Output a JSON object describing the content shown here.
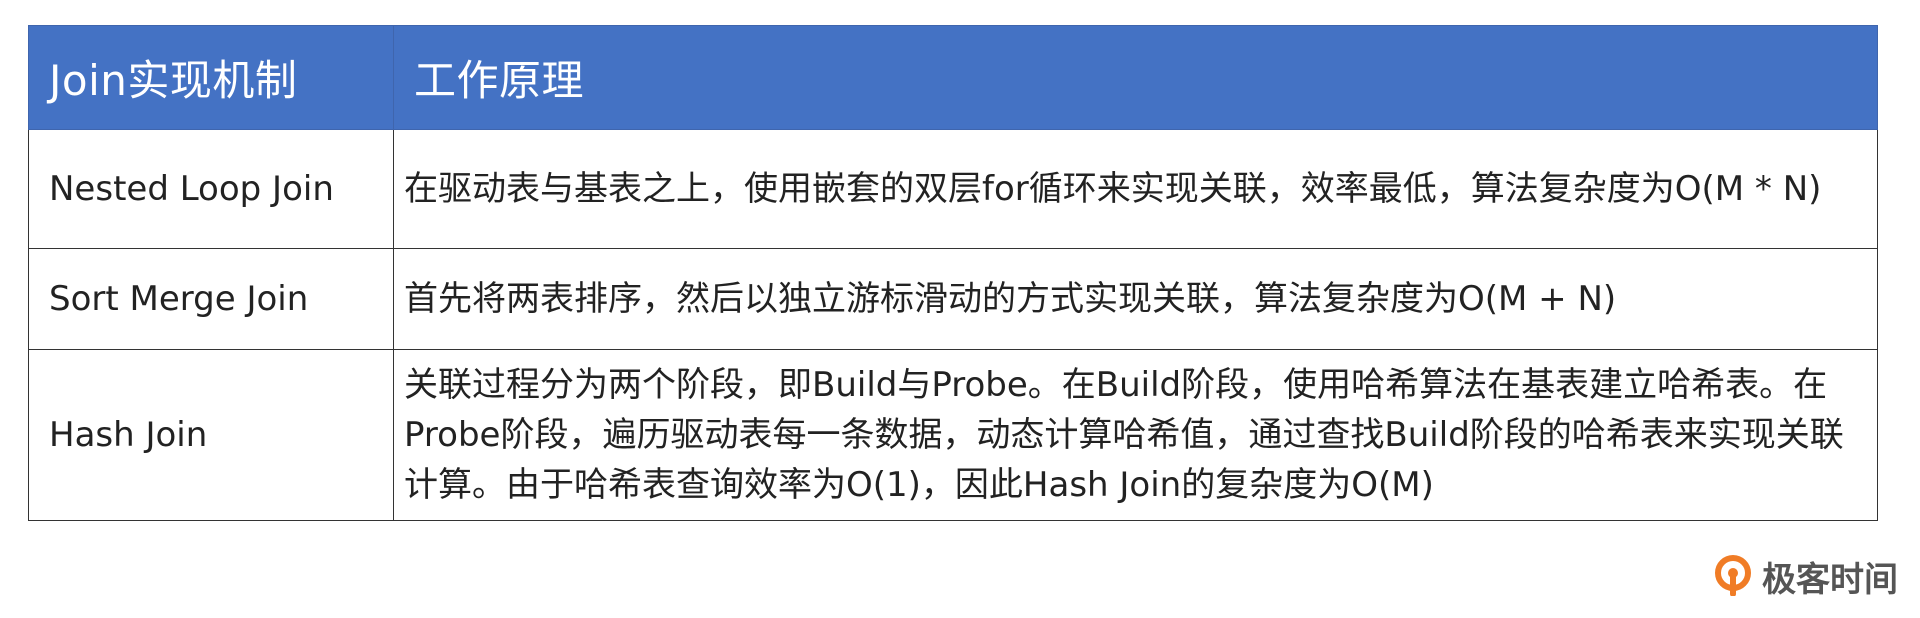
{
  "table": {
    "headers": [
      "Join实现机制",
      "工作原理"
    ],
    "rows": [
      {
        "mechanism": "Nested Loop Join",
        "principle": " 在驱动表与基表之上，使用嵌套的双层for循环来实现关联，效率最低，算法复杂度为O(M * N)"
      },
      {
        "mechanism": "Sort Merge Join",
        "principle": " 首先将两表排序，然后以独立游标滑动的方式实现关联，算法复杂度为O(M + N)"
      },
      {
        "mechanism": "Hash Join",
        "principle": " 关联过程分为两个阶段，即Build与Probe。在Build阶段，使用哈希算法在基表建立哈希表。在Probe阶段，遍历驱动表每一条数据，动态计算哈希值，通过查找Build阶段的哈希表来实现关联计算。由于哈希表查询效率为O(1)，因此Hash Join的复杂度为O(M)"
      }
    ]
  },
  "logo": {
    "text": "极客时间",
    "icon": "geektime-logo-icon"
  },
  "colors": {
    "header_bg": "#4472c4",
    "header_text": "#ffffff",
    "logo_orange": "#f07c26"
  }
}
